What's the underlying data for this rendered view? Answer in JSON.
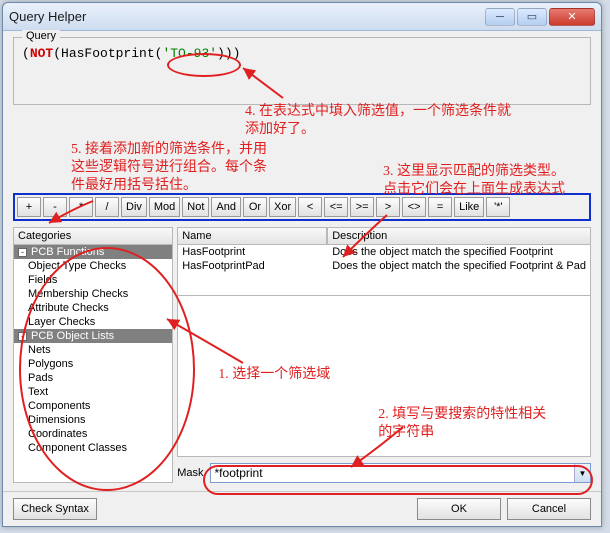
{
  "window": {
    "title": "Query Helper"
  },
  "query": {
    "group_label": "Query",
    "expression_prefix": "(",
    "expression_kw": "NOT",
    "expression_mid1": "(HasFootprint(",
    "expression_str": "'TO-93'",
    "expression_mid2": ")))"
  },
  "operators": [
    "+",
    "-",
    "*",
    "/",
    "Div",
    "Mod",
    "Not",
    "And",
    "Or",
    "Xor",
    "<",
    "<=",
    ">=",
    ">",
    "<>",
    "=",
    "Like",
    "'*'"
  ],
  "categories": {
    "header": "Categories",
    "groups": [
      {
        "label": "PCB Functions",
        "items": [
          "Object Type Checks",
          "Fields",
          "Membership Checks",
          "Attribute Checks",
          "Layer Checks"
        ]
      },
      {
        "label": "PCB Object Lists",
        "items": [
          "Nets",
          "Polygons",
          "Pads",
          "Text",
          "Components",
          "Dimensions",
          "Coordinates",
          "Component Classes"
        ]
      }
    ]
  },
  "name_desc": {
    "name_header": "Name",
    "desc_header": "Description",
    "rows": [
      {
        "name": "HasFootprint",
        "desc": "Does the object match the specified Footprint"
      },
      {
        "name": "HasFootprintPad",
        "desc": "Does the object match the specified Footprint & Pad"
      }
    ]
  },
  "mask": {
    "label": "Mask",
    "value": "*footprint"
  },
  "footer": {
    "check_syntax": "Check Syntax",
    "ok": "OK",
    "cancel": "Cancel"
  },
  "annotations": {
    "a1": "1. 选择一个筛选域",
    "a2": "2. 填写与要搜索的特性相关\n的字符串",
    "a3": "3. 这里显示匹配的筛选类型。\n点击它们会在上面生成表达式",
    "a4": "4. 在表达式中填入筛选值，一个筛选条件就\n添加好了。",
    "a5": "5. 接着添加新的筛选条件，并用\n这些逻辑符号进行组合。每个条\n件最好用括号括住。"
  }
}
